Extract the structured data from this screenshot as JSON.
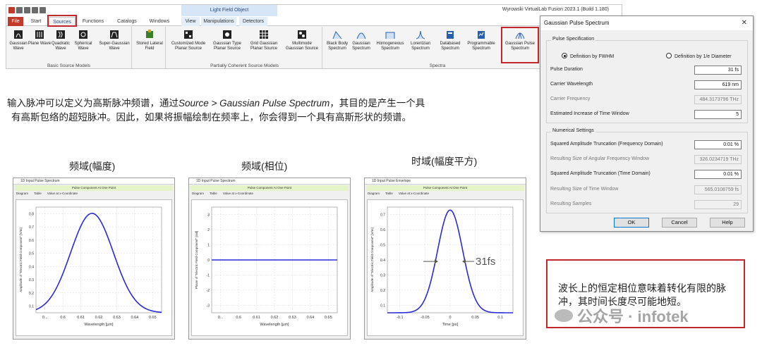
{
  "ribbon": {
    "app_title": "Wyrowski VirtualLab Fusion 2023.1 (Build 1.180)",
    "context_title": "Light Field Object",
    "tabs": [
      "File",
      "Start",
      "Sources",
      "Functions",
      "Catalogs",
      "Windows",
      "View",
      "Manipulations",
      "Detectors"
    ],
    "active_tab": "Sources",
    "groups": [
      {
        "label": "Basic Source Models",
        "buttons": [
          "Gaussian Wave",
          "Plane Wave",
          "Quadratic Wave",
          "Spherical Wave",
          "Super-Gaussian Wave"
        ]
      },
      {
        "label": "",
        "buttons": [
          "Stored Lateral Field"
        ]
      },
      {
        "label": "Partially Coherent Source Models",
        "buttons": [
          "Customized Mode Planar Source",
          "Gaussian Type Planar Source",
          "Grid Gaussian Planar Source",
          "Multimode Gaussian Source"
        ]
      },
      {
        "label": "Spectra",
        "buttons": [
          "Black Body Spectrum",
          "Gaussian Spectrum",
          "Homogeneous Spectrum",
          "Lorentzian Spectrum",
          "Databased Spectrum",
          "Programmable Spectrum",
          "Gaussian Pulse Spectrum"
        ]
      }
    ],
    "highlight_color": "#c0282c"
  },
  "intro": {
    "line1_a": "输入脉冲可以定义为高斯脉冲频谱，通过",
    "line1_italic": "Source > Gaussian Pulse Spectrum",
    "line1_b": "，其目的是产生一个具",
    "line2": "有高斯包络的超短脉冲。因此，如果将振幅绘制在频率上，你会得到一个具有高斯形状的频谱。"
  },
  "plot_titles": [
    "频域(幅度)",
    "频域(相位)",
    "时域(幅度平方)"
  ],
  "plots": [
    {
      "window_title": "1D Input Pulse Spectrum",
      "band": "Pulse Component At One Point",
      "tabs": [
        "Diagram",
        "Table",
        "Value at x-Coordinate"
      ],
      "ylabel": "Amplitude of \"Electric Field Component\" [V/m]",
      "xlabel": "Wavelength [µm]",
      "xticks": [
        "0...",
        "0.6",
        "0.61",
        "0.62",
        "0.63",
        "0.64",
        "0.65"
      ],
      "yticks": [
        "0.1",
        "0.2",
        "0.3",
        "0.4",
        "0.5",
        "0.6",
        "0.7",
        "0.8"
      ]
    },
    {
      "window_title": "1D Input Pulse Spectrum",
      "band": "Pulse Component At One Point",
      "tabs": [
        "Diagram",
        "Table",
        "Value at x-Coordinate"
      ],
      "ylabel": "Phase of \"Electric Field Component\" [rad]",
      "xlabel": "Wavelength [µm]",
      "xticks": [
        "0...",
        "0.6",
        "0.61",
        "0.62",
        "0.63",
        "0.64",
        "0.65"
      ],
      "yticks": [
        "-3",
        "-2",
        "-1",
        "0",
        "1",
        "2",
        "3"
      ]
    },
    {
      "window_title": "1D Input Pulse Envelope",
      "band": "Pulse Component At One Point",
      "tabs": [
        "Diagram",
        "Table",
        "Value at x-Coordinate"
      ],
      "ylabel": "Amplitude of \"Electric Field Component\" [V/m]",
      "xlabel": "Time [ps]",
      "xticks": [
        "-0.1",
        "-0.05",
        "0",
        "0.05",
        "0.1"
      ],
      "yticks": [
        "0.1",
        "0.2",
        "0.3",
        "0.4",
        "0.5",
        "0.6",
        "0.7"
      ],
      "annotation": "31fs"
    }
  ],
  "chart_data": [
    {
      "type": "line",
      "x_range": [
        0.59,
        0.655
      ],
      "ylim": [
        0,
        0.85
      ],
      "series": [
        {
          "shape": "gaussian",
          "center": 0.619,
          "peak": 0.8
        }
      ]
    },
    {
      "type": "line",
      "x_range": [
        0.59,
        0.655
      ],
      "ylim": [
        -3.5,
        3.5
      ],
      "series": [
        {
          "shape": "constant",
          "value": 0
        }
      ]
    },
    {
      "type": "line",
      "x_range": [
        -0.125,
        0.125
      ],
      "ylim": [
        0,
        0.72
      ],
      "series": [
        {
          "shape": "gaussian",
          "center": 0,
          "peak": 0.7,
          "fwhm": 0.031
        }
      ]
    }
  ],
  "dialog": {
    "title": "Gaussian Pulse Spectrum",
    "close": "✕",
    "pulse_spec_legend": "Pulse Specification",
    "radio_fwhm": "Definition by FWHM",
    "radio_1e": "Definition by 1/e Diameter",
    "fields": [
      {
        "label": "Pulse Duration",
        "value": "31 fs",
        "editable": true
      },
      {
        "label": "Carrier Wavelength",
        "value": "619 nm",
        "editable": true
      },
      {
        "label": "Carrier Frequency",
        "value": "484.3173796 THz",
        "editable": false
      },
      {
        "label": "Estimated Increase of Time Window",
        "value": "5",
        "editable": true
      }
    ],
    "numerical_legend": "Numerical Settings",
    "num_fields": [
      {
        "label": "Squared Amplitude Truncation (Frequency Domain)",
        "value": "0.01 %",
        "editable": true
      },
      {
        "label": "Resulting Size of Angular Frequency Window",
        "value": "326.0234719 THz",
        "editable": false
      },
      {
        "label": "Squared Amplitude Truncation (Time Domain)",
        "value": "0.01 %",
        "editable": true
      },
      {
        "label": "Resulting Size of Time Window",
        "value": "565.0108759 fs",
        "editable": false
      },
      {
        "label": "Resulting Samples",
        "value": "29",
        "editable": false
      }
    ],
    "ok": "OK",
    "cancel": "Cancel",
    "help": "Help"
  },
  "note": {
    "text": "波长上的恒定相位意味着转化有限的脉冲，其时间长度尽可能地短。"
  },
  "watermark": "公众号 · infotek",
  "colors": {
    "curve": "#2a2ad8",
    "accent": "#c0282c",
    "band": "#e5f3c8"
  }
}
